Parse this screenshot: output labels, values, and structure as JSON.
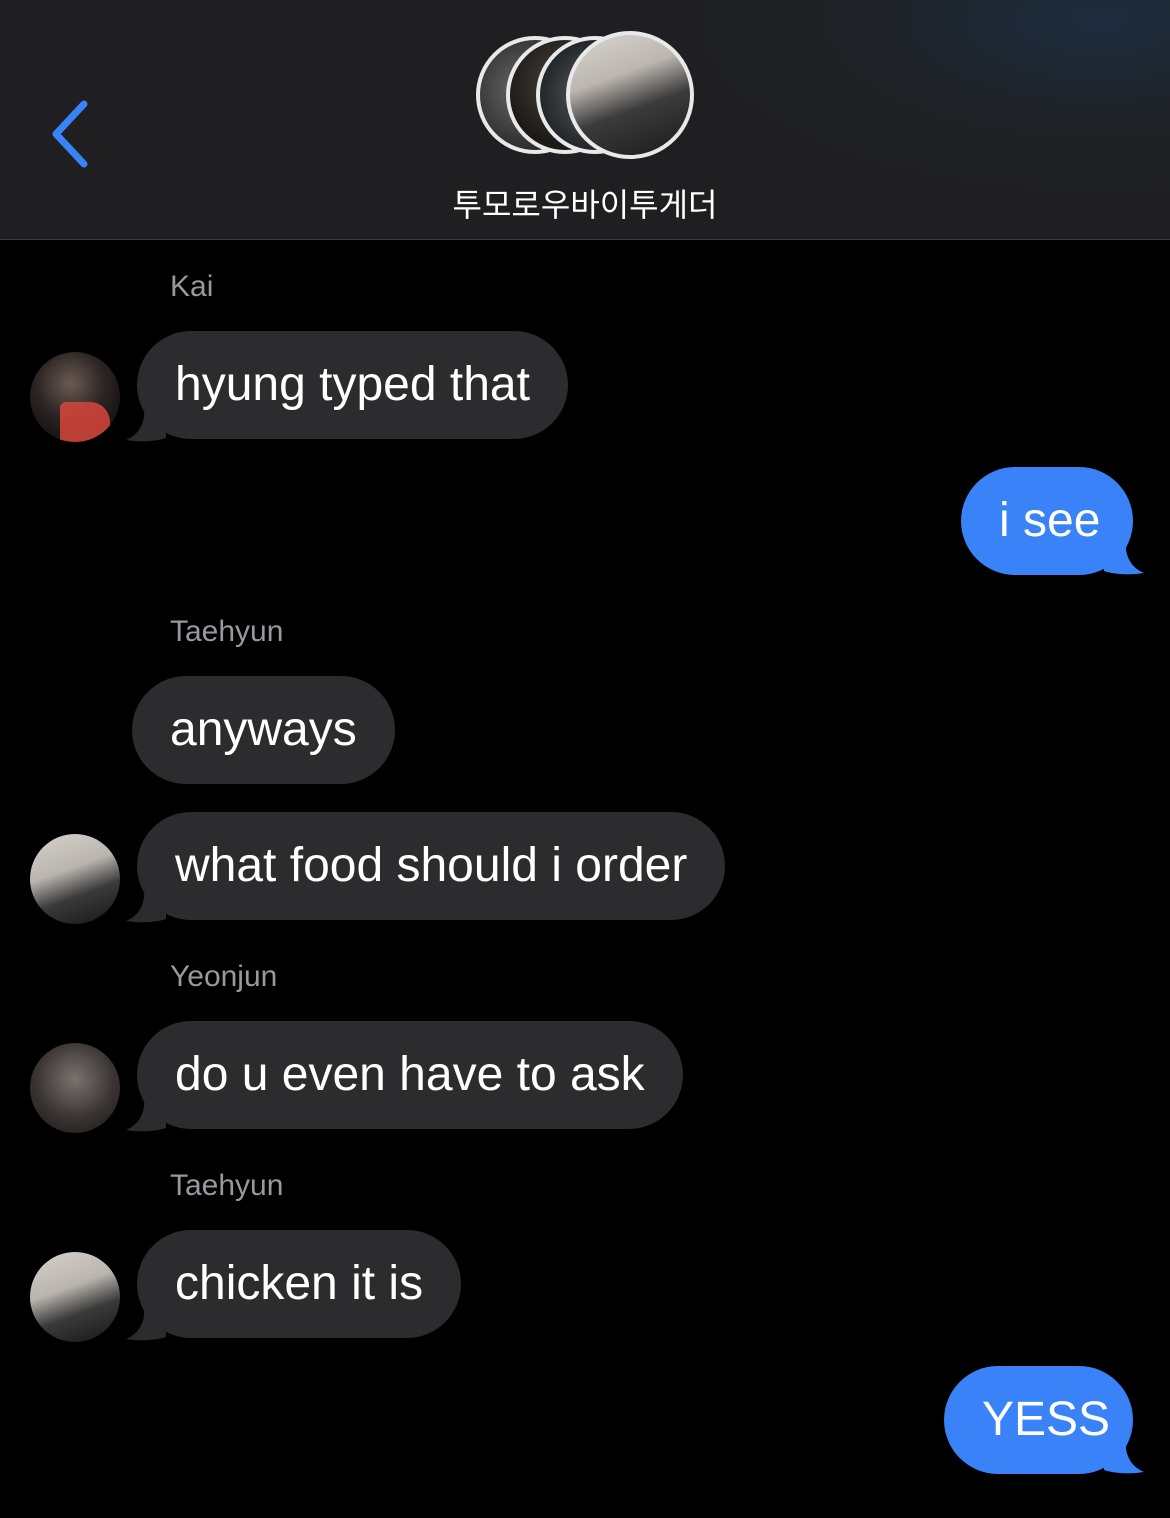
{
  "header": {
    "title": "투모로우바이투게더",
    "back_icon": "chevron-left-icon",
    "accent_color": "#3a82f7"
  },
  "messages": [
    {
      "sender": "Kai",
      "text": "hyung typed that",
      "direction": "incoming"
    },
    {
      "sender": "",
      "text": "i see",
      "direction": "outgoing"
    },
    {
      "sender": "Taehyun",
      "text": "anyways",
      "direction": "incoming"
    },
    {
      "sender": "",
      "text": "what food should i order",
      "direction": "incoming"
    },
    {
      "sender": "Yeonjun",
      "text": "do u even have to ask",
      "direction": "incoming"
    },
    {
      "sender": "Taehyun",
      "text": "chicken it is",
      "direction": "incoming"
    },
    {
      "sender": "",
      "text": "YESS",
      "direction": "outgoing"
    }
  ],
  "colors": {
    "incoming_bubble": "#2c2c2e",
    "outgoing_bubble": "#3a82f7",
    "background": "#000000",
    "sender_label": "#98989f"
  }
}
